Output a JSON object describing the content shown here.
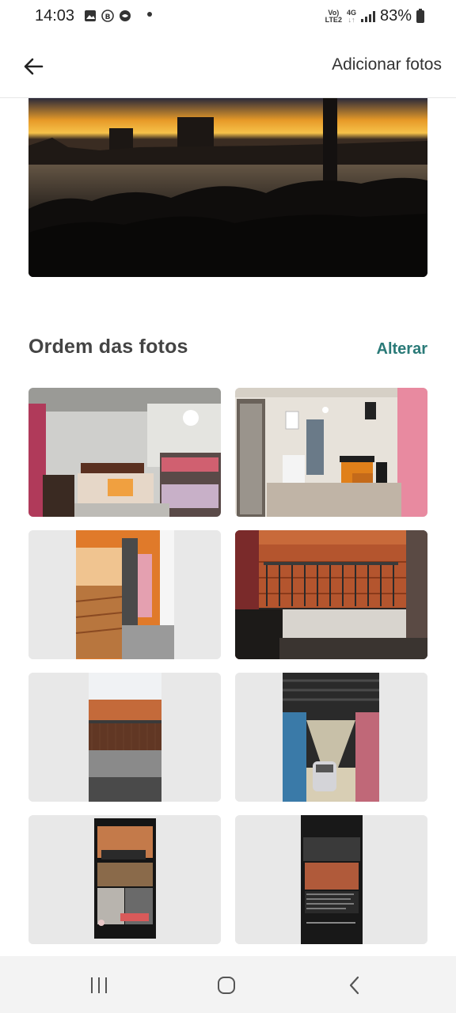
{
  "status_bar": {
    "time": "14:03",
    "network_top": "Vo)",
    "network_bottom": "LTE2",
    "network_type": "4G",
    "battery": "83%"
  },
  "app_bar": {
    "back_icon": "arrow-left-icon",
    "add_photos_label": "Adicionar fotos"
  },
  "section": {
    "title": "Ordem das fotos",
    "change_label": "Alterar"
  },
  "photos": [
    {
      "name": "bedroom"
    },
    {
      "name": "kitchen"
    },
    {
      "name": "balcony-door"
    },
    {
      "name": "balcony-view"
    },
    {
      "name": "balcony-rooftops"
    },
    {
      "name": "corridor-parking"
    },
    {
      "name": "screenshot-ad-1"
    },
    {
      "name": "screenshot-ad-2"
    }
  ],
  "nav_bar": {
    "icons": [
      "recent-apps-icon",
      "home-icon",
      "back-nav-icon"
    ]
  },
  "colors": {
    "accent": "#2a7a78",
    "tile_background": "#e8e8e8"
  }
}
